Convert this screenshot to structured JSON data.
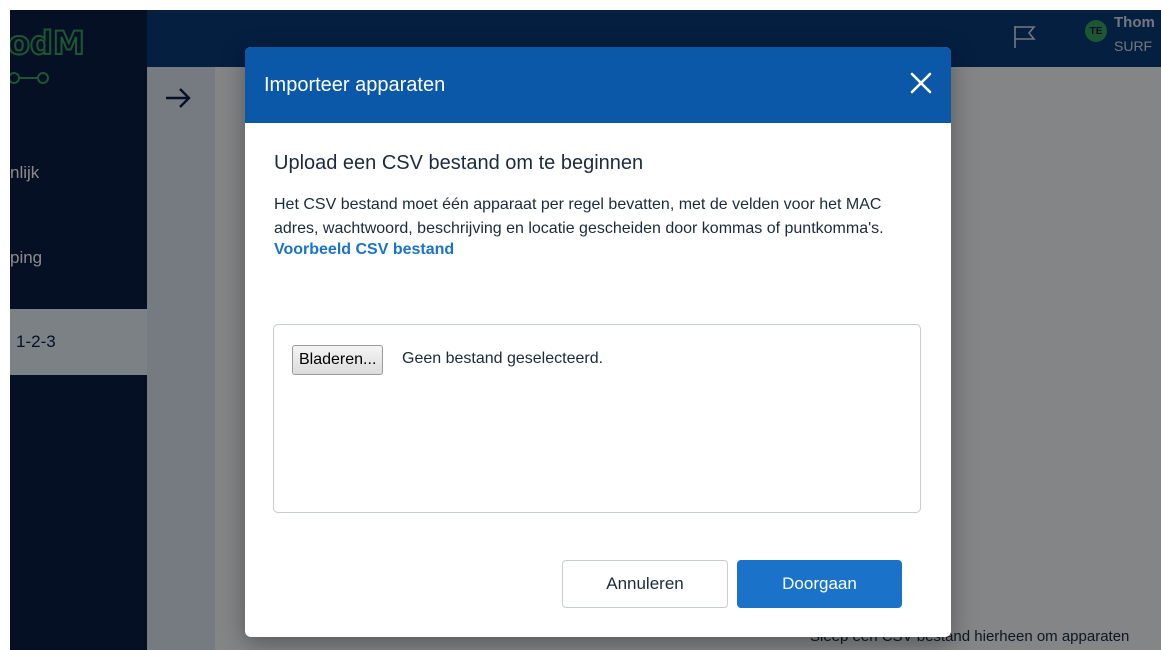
{
  "background": {
    "logo_text": "odM",
    "sidebar": {
      "items": [
        {
          "label": "nlijk"
        },
        {
          "label": "ping"
        },
        {
          "label": "1-2-3",
          "active": true
        }
      ]
    },
    "user": {
      "initials": "TE",
      "name": "Thom",
      "org": "SURF"
    },
    "drop_hint": "Sleep een CSV bestand hierheen om apparaten"
  },
  "modal": {
    "title": "Importeer apparaten",
    "heading": "Upload een CSV bestand om te beginnen",
    "description": "Het CSV bestand moet één apparaat per regel bevatten, met de velden voor het MAC adres, wachtwoord, beschrijving en locatie gescheiden door kommas of puntkomma's.",
    "example_link": "Voorbeeld CSV bestand",
    "file_input": {
      "button_label": "Bladeren...",
      "status": "Geen bestand geselecteerd."
    },
    "cancel_label": "Annuleren",
    "continue_label": "Doorgaan"
  },
  "colors": {
    "primary": "#1a73c8",
    "header": "#0b57a8",
    "sidebar": "#0b1f45",
    "brand_green": "#37a05f"
  }
}
